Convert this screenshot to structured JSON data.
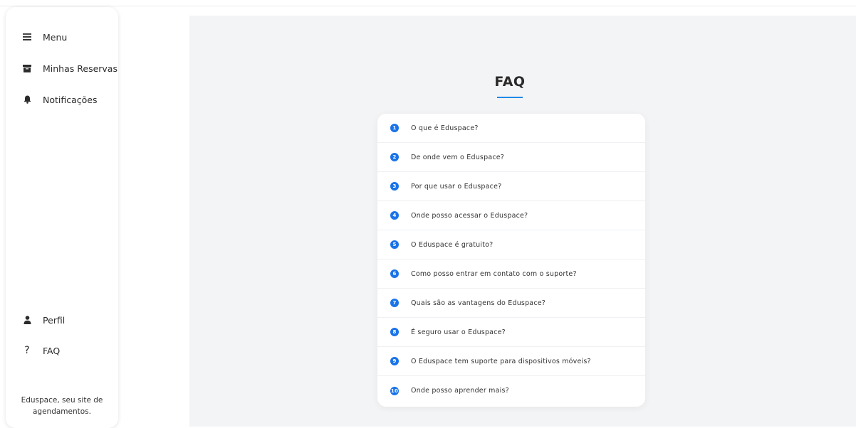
{
  "sidebar": {
    "items_top": [
      {
        "label": "Menu",
        "icon": "hamburger-icon"
      },
      {
        "label": "Minhas Reservas",
        "icon": "archive-icon"
      },
      {
        "label": "Notificações",
        "icon": "bell-icon"
      }
    ],
    "items_bottom": [
      {
        "label": "Perfil",
        "icon": "user-icon"
      },
      {
        "label": "FAQ",
        "icon": "question-icon"
      }
    ],
    "footer_line1": "Eduspace, seu site de",
    "footer_line2": "agendamentos."
  },
  "main": {
    "title": "FAQ",
    "accent_color": "#1a73e8",
    "questions": [
      {
        "number": "1",
        "text": "O que é Eduspace?"
      },
      {
        "number": "2",
        "text": "De onde vem o Eduspace?"
      },
      {
        "number": "3",
        "text": "Por que usar o Eduspace?"
      },
      {
        "number": "4",
        "text": "Onde posso acessar o Eduspace?"
      },
      {
        "number": "5",
        "text": "O Eduspace é gratuito?"
      },
      {
        "number": "6",
        "text": "Como posso entrar em contato com o suporte?"
      },
      {
        "number": "7",
        "text": "Quais são as vantagens do Eduspace?"
      },
      {
        "number": "8",
        "text": "É seguro usar o Eduspace?"
      },
      {
        "number": "9",
        "text": "O Eduspace tem suporte para dispositivos móveis?"
      },
      {
        "number": "10",
        "text": "Onde posso aprender mais?"
      }
    ]
  }
}
